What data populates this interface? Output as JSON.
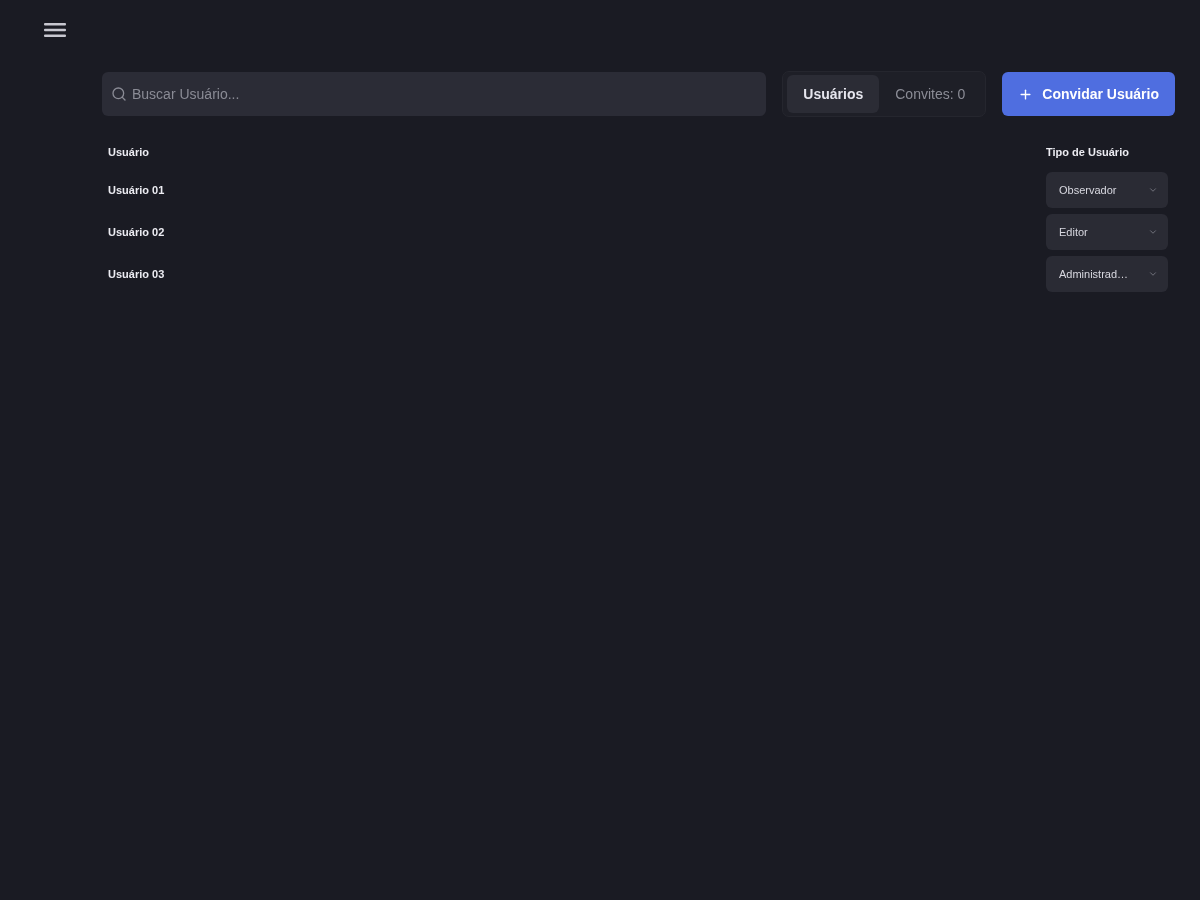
{
  "search": {
    "placeholder": "Buscar Usuário..."
  },
  "tabs": [
    {
      "label": "Usuários",
      "selected": true
    },
    {
      "label": "Convites: 0",
      "selected": false
    }
  ],
  "invite_button": {
    "label": "Convidar Usuário"
  },
  "table": {
    "columns": [
      "Usuário",
      "Tipo de Usuário"
    ],
    "rows": [
      {
        "user": "Usuário 01",
        "type": "Observador"
      },
      {
        "user": "Usuário 02",
        "type": "Editor"
      },
      {
        "user": "Usuário 03",
        "type": "Administrad…"
      }
    ]
  }
}
